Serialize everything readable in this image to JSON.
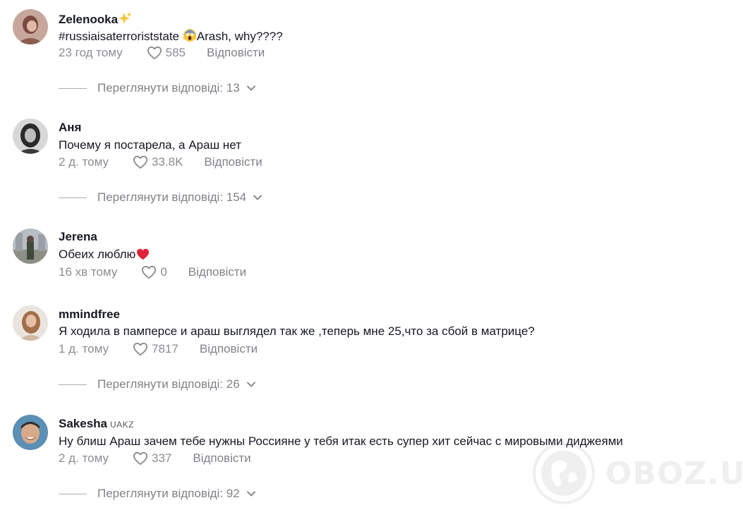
{
  "comments": [
    {
      "username": "Zelenooka",
      "badge": "",
      "text": "#russiaisaterroriststate",
      "text_suffix": "Arash, why????",
      "time": "23 год тому",
      "likes": "585",
      "reply_label": "Відповісти",
      "replies_label": "Переглянути відповіді: 13"
    },
    {
      "username": "Аня",
      "badge": "",
      "text": "Почему я постарела, а Араш нет",
      "time": "2 д. тому",
      "likes": "33.8K",
      "reply_label": "Відповісти",
      "replies_label": "Переглянути відповіді: 154"
    },
    {
      "username": "Jerena",
      "badge": "",
      "text": "Обеих люблю",
      "time": "16 хв тому",
      "likes": "0",
      "reply_label": "Відповісти",
      "replies_label": ""
    },
    {
      "username": "mmindfree",
      "badge": "",
      "text": "Я ходила в памперсе и араш выглядел так же ,теперь мне 25,что за сбой в матрице?",
      "time": "1 д. тому",
      "likes": "7817",
      "reply_label": "Відповісти",
      "replies_label": "Переглянути відповіді: 26"
    },
    {
      "username": "Sakesha",
      "badge": "UAKZ",
      "text": "Ну блиш Араш зачем тебе нужны Россияне у тебя итак есть супер хит сейчас с мировыми диджеями",
      "time": "2 д. тому",
      "likes": "337",
      "reply_label": "Відповісти",
      "replies_label": "Переглянути відповіді: 92"
    }
  ],
  "watermark": {
    "text": "OBOZ.UA"
  },
  "icons": {
    "like": "heart-outline-icon",
    "expand": "chevron-down-icon",
    "sparkle": "sparkles-emoji",
    "scream": "screaming-face-emoji",
    "heart": "red-heart-emoji"
  },
  "colors": {
    "text": "#161823",
    "muted": "#8a8b91",
    "heart_red": "#e0243b",
    "sparkle": "#f5c53a"
  }
}
